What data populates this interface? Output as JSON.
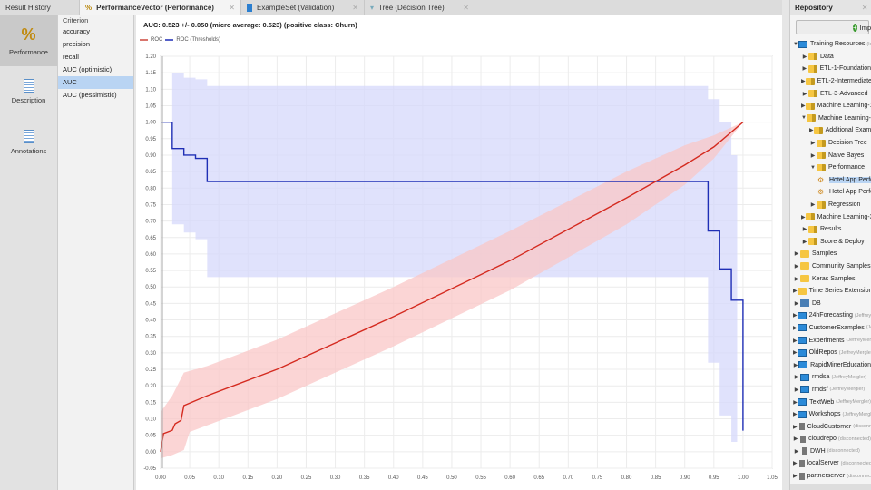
{
  "tabs": [
    {
      "label": "Result History"
    },
    {
      "label": "PerformanceVector (Performance)",
      "active": true
    },
    {
      "label": "ExampleSet (Validation)"
    },
    {
      "label": "Tree (Decision Tree)"
    }
  ],
  "left_nav": [
    {
      "label": "Performance",
      "icon": "percent-icon"
    },
    {
      "label": "Description",
      "icon": "document-icon"
    },
    {
      "label": "Annotations",
      "icon": "notes-icon"
    }
  ],
  "criteria": {
    "header": "Criterion",
    "items": [
      "accuracy",
      "precision",
      "recall",
      "AUC (optimistic)",
      "AUC",
      "AUC (pessimistic)"
    ],
    "selected": "AUC"
  },
  "chart_data": {
    "type": "line",
    "title": "AUC: 0.523 +/- 0.050 (micro average: 0.523) (positive class: Churn)",
    "legend": [
      "ROC",
      "ROC (Thresholds)"
    ],
    "legend_position": "top-left",
    "colors": {
      "roc": "#d42a1f",
      "roc_band": "#f9c7c7",
      "thr": "#1f2fb5",
      "thr_band": "#d6d8fb"
    },
    "xlim": [
      0,
      1.05
    ],
    "ylim": [
      -0.05,
      1.2
    ],
    "xticks": [
      "0.00",
      "0.05",
      "0.10",
      "0.15",
      "0.20",
      "0.25",
      "0.30",
      "0.35",
      "0.40",
      "0.45",
      "0.50",
      "0.55",
      "0.60",
      "0.65",
      "0.70",
      "0.75",
      "0.80",
      "0.85",
      "0.90",
      "0.95",
      "1.00",
      "1.05"
    ],
    "yticks": [
      "-0.05",
      "0.00",
      "0.05",
      "0.10",
      "0.15",
      "0.20",
      "0.25",
      "0.30",
      "0.35",
      "0.40",
      "0.45",
      "0.50",
      "0.55",
      "0.60",
      "0.65",
      "0.70",
      "0.75",
      "0.80",
      "0.85",
      "0.90",
      "0.95",
      "1.00",
      "1.05",
      "1.10",
      "1.15",
      "1.20"
    ],
    "series": [
      {
        "name": "ROC",
        "points": [
          [
            0,
            0
          ],
          [
            0.005,
            0.055
          ],
          [
            0.02,
            0.065
          ],
          [
            0.025,
            0.085
          ],
          [
            0.035,
            0.095
          ],
          [
            0.04,
            0.14
          ],
          [
            0.08,
            0.17
          ],
          [
            0.2,
            0.25
          ],
          [
            0.4,
            0.41
          ],
          [
            0.6,
            0.58
          ],
          [
            0.8,
            0.77
          ],
          [
            0.9,
            0.87
          ],
          [
            0.95,
            0.925
          ],
          [
            1,
            1
          ]
        ],
        "band_upper": [
          [
            0,
            0.12
          ],
          [
            0.02,
            0.17
          ],
          [
            0.04,
            0.24
          ],
          [
            0.08,
            0.26
          ],
          [
            0.2,
            0.34
          ],
          [
            0.4,
            0.5
          ],
          [
            0.6,
            0.67
          ],
          [
            0.8,
            0.85
          ],
          [
            0.9,
            0.93
          ],
          [
            0.95,
            0.96
          ],
          [
            1,
            1
          ]
        ],
        "band_lower": [
          [
            0,
            -0.02
          ],
          [
            0.02,
            -0.01
          ],
          [
            0.04,
            0.005
          ],
          [
            0.05,
            0.06
          ],
          [
            0.08,
            0.08
          ],
          [
            0.2,
            0.16
          ],
          [
            0.4,
            0.32
          ],
          [
            0.6,
            0.49
          ],
          [
            0.8,
            0.69
          ],
          [
            0.9,
            0.81
          ],
          [
            0.95,
            0.89
          ],
          [
            1,
            1
          ]
        ]
      },
      {
        "name": "ROC (Thresholds)",
        "points": [
          [
            0,
            1
          ],
          [
            0.02,
            1
          ],
          [
            0.02,
            0.92
          ],
          [
            0.04,
            0.92
          ],
          [
            0.04,
            0.9
          ],
          [
            0.06,
            0.9
          ],
          [
            0.06,
            0.89
          ],
          [
            0.08,
            0.89
          ],
          [
            0.08,
            0.82
          ],
          [
            0.94,
            0.82
          ],
          [
            0.94,
            0.67
          ],
          [
            0.96,
            0.67
          ],
          [
            0.96,
            0.555
          ],
          [
            0.98,
            0.555
          ],
          [
            0.98,
            0.46
          ],
          [
            1,
            0.46
          ],
          [
            1,
            0.064
          ]
        ],
        "band_upper": [
          [
            0.02,
            1.15
          ],
          [
            0.04,
            1.15
          ],
          [
            0.04,
            1.135
          ],
          [
            0.06,
            1.135
          ],
          [
            0.06,
            1.13
          ],
          [
            0.08,
            1.13
          ],
          [
            0.08,
            1.11
          ],
          [
            0.94,
            1.11
          ],
          [
            0.94,
            1.07
          ],
          [
            0.96,
            1.07
          ],
          [
            0.96,
            1.0
          ],
          [
            0.98,
            1.0
          ],
          [
            0.98,
            0.9
          ],
          [
            0.99,
            0.9
          ]
        ],
        "band_lower": [
          [
            0.02,
            0.69
          ],
          [
            0.04,
            0.69
          ],
          [
            0.04,
            0.665
          ],
          [
            0.06,
            0.665
          ],
          [
            0.06,
            0.645
          ],
          [
            0.08,
            0.645
          ],
          [
            0.08,
            0.53
          ],
          [
            0.94,
            0.53
          ],
          [
            0.94,
            0.27
          ],
          [
            0.96,
            0.27
          ],
          [
            0.96,
            0.11
          ],
          [
            0.98,
            0.11
          ],
          [
            0.98,
            0.03
          ],
          [
            0.99,
            0.03
          ]
        ]
      }
    ]
  },
  "repository": {
    "tab": "Repository",
    "import_label": "Import",
    "items": [
      {
        "label": "Training Resources",
        "sub": "(local)",
        "depth": 0,
        "arrow": "down",
        "icon": "mon"
      },
      {
        "label": "Data",
        "depth": 1,
        "arrow": "right",
        "icon": "res"
      },
      {
        "label": "ETL-1-Foundation",
        "depth": 1,
        "arrow": "right",
        "icon": "res"
      },
      {
        "label": "ETL-2-Intermediate",
        "depth": 1,
        "arrow": "right",
        "icon": "res"
      },
      {
        "label": "ETL-3-Advanced",
        "depth": 1,
        "arrow": "right",
        "icon": "res"
      },
      {
        "label": "Machine Learning-1",
        "depth": 1,
        "arrow": "right",
        "icon": "res"
      },
      {
        "label": "Machine Learning-2",
        "depth": 1,
        "arrow": "down",
        "icon": "res"
      },
      {
        "label": "Additional Examples",
        "depth": 2,
        "arrow": "right",
        "icon": "res"
      },
      {
        "label": "Decision Tree",
        "depth": 2,
        "arrow": "right",
        "icon": "res"
      },
      {
        "label": "Naive Bayes",
        "depth": 2,
        "arrow": "right",
        "icon": "res"
      },
      {
        "label": "Performance",
        "depth": 2,
        "arrow": "down",
        "icon": "res"
      },
      {
        "label": "Hotel App Performance",
        "depth": 3,
        "arrow": "",
        "icon": "proc",
        "selected": true
      },
      {
        "label": "Hotel App Performance",
        "depth": 3,
        "arrow": "",
        "icon": "proc"
      },
      {
        "label": "Regression",
        "depth": 2,
        "arrow": "right",
        "icon": "res"
      },
      {
        "label": "Machine Learning-3",
        "depth": 1,
        "arrow": "right",
        "icon": "res"
      },
      {
        "label": "Results",
        "depth": 1,
        "arrow": "right",
        "icon": "res"
      },
      {
        "label": "Score & Deploy",
        "depth": 1,
        "arrow": "right",
        "icon": "res"
      },
      {
        "label": "Samples",
        "depth": 0,
        "arrow": "right",
        "icon": "fold"
      },
      {
        "label": "Community Samples",
        "depth": 0,
        "arrow": "right",
        "icon": "fold"
      },
      {
        "label": "Keras Samples",
        "depth": 0,
        "arrow": "right",
        "icon": "fold"
      },
      {
        "label": "Time Series Extension",
        "depth": 0,
        "arrow": "right",
        "icon": "fold"
      },
      {
        "label": "DB",
        "depth": 0,
        "arrow": "right",
        "icon": "db"
      },
      {
        "label": "24hForecasting",
        "sub": "(JeffreyMergler)",
        "depth": 0,
        "arrow": "right",
        "icon": "mon"
      },
      {
        "label": "CustomerExamples",
        "sub": "(JeffreyMergler)",
        "depth": 0,
        "arrow": "right",
        "icon": "mon"
      },
      {
        "label": "Experiments",
        "sub": "(JeffreyMergler)",
        "depth": 0,
        "arrow": "right",
        "icon": "mon"
      },
      {
        "label": "OldRepos",
        "sub": "(JeffreyMergler)",
        "depth": 0,
        "arrow": "right",
        "icon": "mon"
      },
      {
        "label": "RapidMinerEducation",
        "depth": 0,
        "arrow": "right",
        "icon": "mon"
      },
      {
        "label": "rmdsa",
        "sub": "(JeffreyMergler)",
        "depth": 0,
        "arrow": "right",
        "icon": "mon"
      },
      {
        "label": "rmdsf",
        "sub": "(JeffreyMergler)",
        "depth": 0,
        "arrow": "right",
        "icon": "mon"
      },
      {
        "label": "TextWeb",
        "sub": "(JeffreyMergler)",
        "depth": 0,
        "arrow": "right",
        "icon": "mon"
      },
      {
        "label": "Workshops",
        "sub": "(JeffreyMergler)",
        "depth": 0,
        "arrow": "right",
        "icon": "mon"
      },
      {
        "label": "CloudCustomer",
        "sub": "(disconnected)",
        "depth": 0,
        "arrow": "right",
        "icon": "srv"
      },
      {
        "label": "cloudrepo",
        "sub": "(disconnected)",
        "depth": 0,
        "arrow": "right",
        "icon": "srv"
      },
      {
        "label": "DWH",
        "sub": "(disconnected)",
        "depth": 0,
        "arrow": "right",
        "icon": "srv"
      },
      {
        "label": "localServer",
        "sub": "(disconnected)",
        "depth": 0,
        "arrow": "right",
        "icon": "srv"
      },
      {
        "label": "partnerserver",
        "sub": "(disconnected)",
        "depth": 0,
        "arrow": "right",
        "icon": "srv"
      }
    ]
  }
}
